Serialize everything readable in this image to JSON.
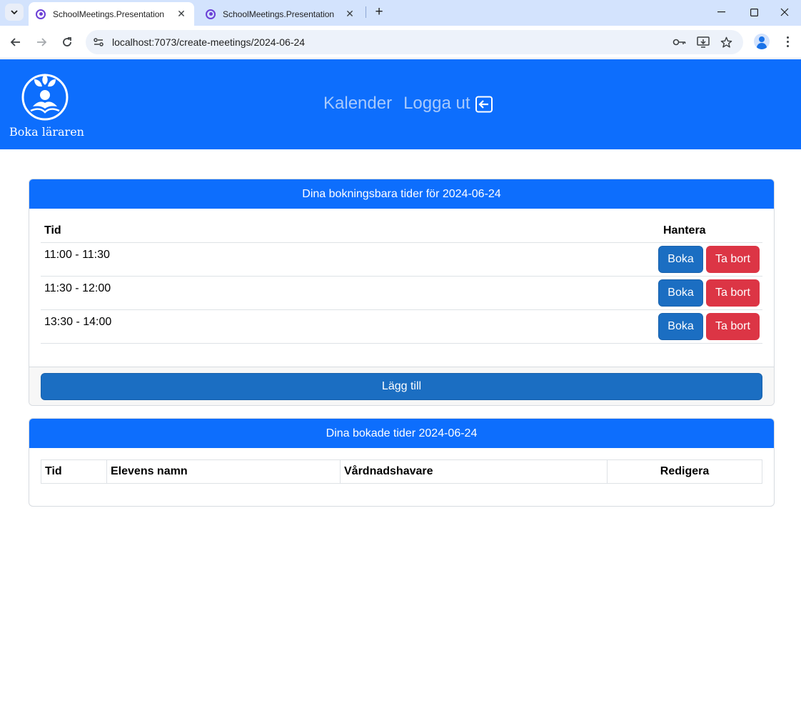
{
  "browser": {
    "tabs": [
      {
        "title": "SchoolMeetings.Presentation",
        "active": true
      },
      {
        "title": "SchoolMeetings.Presentation",
        "active": false
      }
    ],
    "url": "localhost:7073/create-meetings/2024-06-24"
  },
  "header": {
    "brand_name": "Boka läraren",
    "nav": {
      "calendar": "Kalender",
      "logout": "Logga ut"
    }
  },
  "available": {
    "title": "Dina bokningsbara tider för 2024-06-24",
    "columns": {
      "time": "Tid",
      "manage": "Hantera"
    },
    "rows": [
      {
        "time": "11:00 - 11:30"
      },
      {
        "time": "11:30 - 12:00"
      },
      {
        "time": "13:30 - 14:00"
      }
    ],
    "book_label": "Boka",
    "delete_label": "Ta bort",
    "add_label": "Lägg till"
  },
  "booked": {
    "title": "Dina bokade tider 2024-06-24",
    "columns": [
      "Tid",
      "Elevens namn",
      "Vårdnadshavare",
      "Redigera"
    ]
  },
  "colors": {
    "primary": "#0d6efd",
    "button": "#1b6ec2",
    "danger": "#dc3545"
  }
}
